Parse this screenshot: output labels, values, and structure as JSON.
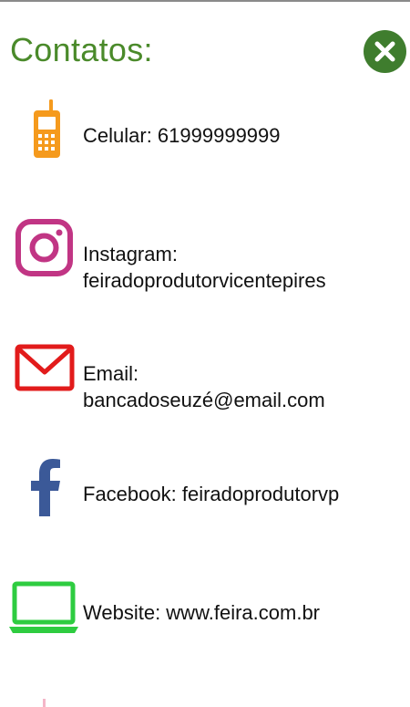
{
  "title": "Contatos:",
  "contacts": {
    "phone": {
      "label": "Celular: 61999999999",
      "icon": "mobile-phone-icon",
      "color": "#f59a1d"
    },
    "instagram": {
      "line1": "Instagram:",
      "line2": "feiradoprodutorvicentepires",
      "icon": "instagram-icon",
      "color": "#c13584"
    },
    "email": {
      "line1": "Email:",
      "line2": "bancadoseuzé@email.com",
      "icon": "envelope-icon",
      "color": "#e21b1b"
    },
    "facebook": {
      "label": "Facebook: feiradoprodutorvp",
      "icon": "facebook-icon",
      "color": "#3b5998"
    },
    "website": {
      "label": "Website: www.feira.com.br",
      "icon": "laptop-icon",
      "color": "#2ecc40"
    }
  },
  "colors": {
    "title": "#4a8a2a",
    "close_button": "#3f7d2e",
    "text": "#111111"
  }
}
